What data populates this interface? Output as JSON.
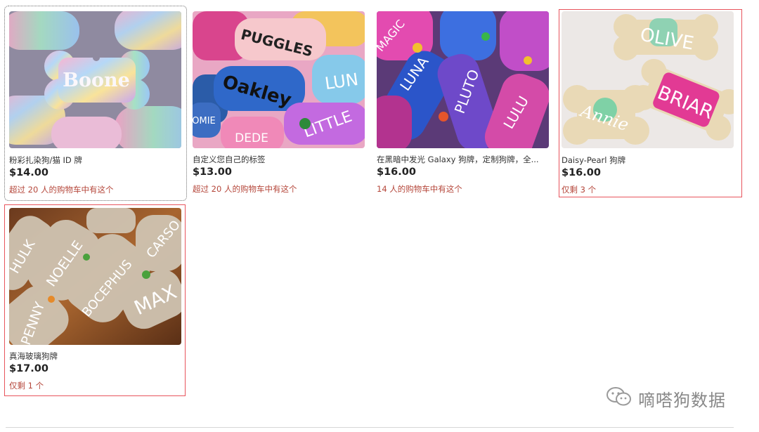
{
  "listings": [
    {
      "title": "粉彩扎染狗/猫 ID 牌",
      "price": "$14.00",
      "note": "超过 20 人的购物车中有这个",
      "image_text": "Boone"
    },
    {
      "title": "自定义您自己的标签",
      "price": "$13.00",
      "note": "超过 20 人的购物车中有这个",
      "image_text": [
        "PUGGLES",
        "Oakley",
        "LUNA",
        "LITTLE",
        "DEDE",
        "OMIE"
      ]
    },
    {
      "title": "在黑暗中发光 Galaxy 狗牌，定制狗牌，全...",
      "price": "$16.00",
      "note": "14 人的购物车中有这个",
      "image_text": [
        "LUNA",
        "PLUTO",
        "LULU",
        "MAGIC"
      ]
    },
    {
      "title": "Daisy-Pearl 狗牌",
      "price": "$16.00",
      "note": "仅剩 3 个",
      "image_text": [
        "OLIVE",
        "BRIAR",
        "Annie"
      ]
    },
    {
      "title": "真海玻璃狗牌",
      "price": "$17.00",
      "note": "仅剩 1 个",
      "image_text": [
        "NOELLE",
        "BOCEPHUS",
        "MAX",
        "CARSO",
        "PENNY",
        "HULK"
      ]
    }
  ],
  "watermark": {
    "text": "嘀嗒狗数据",
    "icon": "wechat-icon"
  },
  "colors": {
    "note": "#b5473b",
    "highlight_border": "#e8545c"
  }
}
